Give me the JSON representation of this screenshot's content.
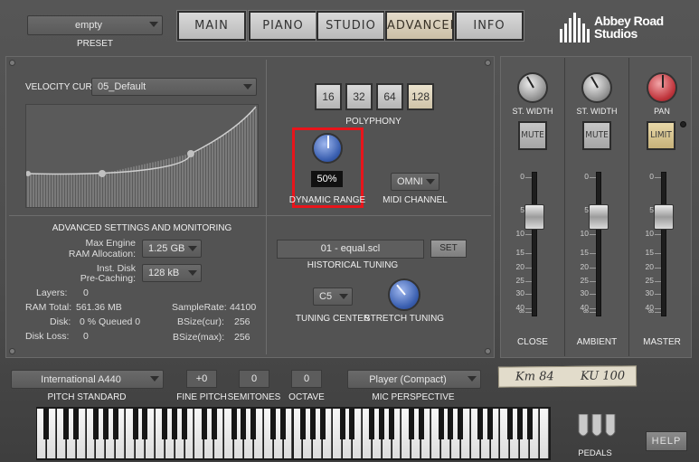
{
  "preset": {
    "value": "empty",
    "label": "PRESET"
  },
  "tabs": [
    "MAIN",
    "PIANO",
    "STUDIO",
    "ADVANCED",
    "INFO"
  ],
  "active_tab": "ADVANCED",
  "logo": {
    "line1": "Abbey Road",
    "line2": "Studios"
  },
  "velocity": {
    "label": "VELOCITY CURVE",
    "value": "05_Default"
  },
  "polyphony": {
    "options": [
      "16",
      "32",
      "64",
      "128"
    ],
    "selected": "128",
    "label": "POLYPHONY"
  },
  "dynamic_range": {
    "value": "50%",
    "label": "DYNAMIC RANGE",
    "level": 0.5
  },
  "midi_channel": {
    "value": "OMNI",
    "label": "MIDI CHANNEL"
  },
  "advanced": {
    "title": "ADVANCED SETTINGS AND MONITORING",
    "max_engine_l1": "Max Engine",
    "max_engine_l2": "RAM Allocation:",
    "max_engine_val": "1.25 GB",
    "inst_disk_l1": "Inst. Disk",
    "inst_disk_l2": "Pre-Caching:",
    "inst_disk_val": "128 kB",
    "layers_label": "Layers:",
    "layers_val": "0",
    "ram_label": "RAM Total:",
    "ram_val": "561.36 MB",
    "disk_label": "Disk:",
    "disk_val": "0 %  Queued 0",
    "diskloss_label": "Disk Loss:",
    "diskloss_val": "0",
    "samplerate_label": "SampleRate:",
    "samplerate_val": "44100",
    "bsize_cur_label": "BSize(cur):",
    "bsize_cur_val": "256",
    "bsize_max_label": "BSize(max):",
    "bsize_max_val": "256"
  },
  "tuning": {
    "scale": "01 - equal.scl",
    "set": "SET",
    "label": "HISTORICAL TUNING",
    "center_value": "C5",
    "center_label": "TUNING CENTER",
    "stretch_label": "STRETCH TUNING"
  },
  "mixer": {
    "channels": [
      {
        "knob_label": "ST. WIDTH",
        "button": "MUTE",
        "name": "CLOSE"
      },
      {
        "knob_label": "ST. WIDTH",
        "button": "MUTE",
        "name": "AMBIENT"
      },
      {
        "knob_label": "PAN",
        "button": "LIMIT",
        "name": "MASTER"
      }
    ],
    "scale": [
      "0",
      "5",
      "10",
      "15",
      "20",
      "25",
      "30",
      "40",
      "∞"
    ]
  },
  "tape": {
    "left": "Km 84",
    "right": "KU 100"
  },
  "bottom": {
    "pitch_standard_value": "International  A440",
    "pitch_standard_label": "PITCH STANDARD",
    "fine_pitch_value": "+0",
    "fine_pitch_label": "FINE PITCH",
    "semitones_value": "0",
    "semitones_label": "SEMITONES",
    "octave_value": "0",
    "octave_label": "OCTAVE",
    "mic_value": "Player (Compact)",
    "mic_label": "MIC PERSPECTIVE",
    "pedals_label": "PEDALS",
    "help": "HELP"
  },
  "colors": {
    "highlight": "#e8151b",
    "knob_blue": "#3a5fb0",
    "pan_red": "#c0353c"
  }
}
